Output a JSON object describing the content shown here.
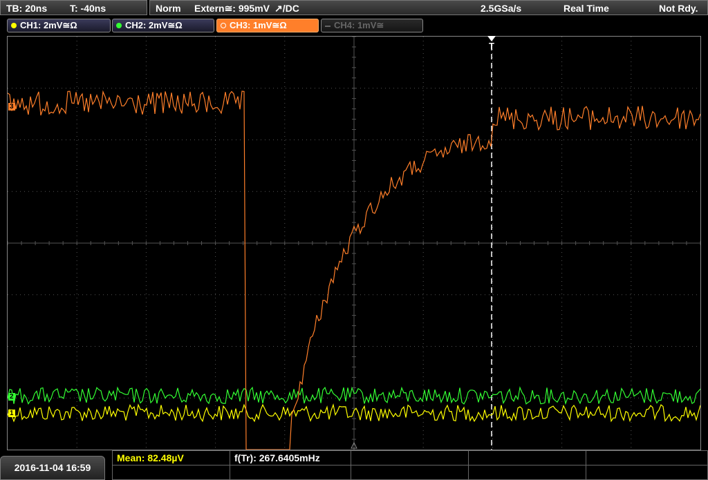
{
  "header": {
    "tb": "TB: 20ns",
    "t": "T: -40ns",
    "mode": "Norm",
    "source": "Extern≅: 995mV",
    "slope": "↗/DC",
    "sample_rate": "2.5GSa/s",
    "acq_mode": "Real Time",
    "status": "Not Rdy."
  },
  "channels": [
    {
      "label": "CH1: 2mV≅Ω",
      "color": "#ffff00"
    },
    {
      "label": "CH2: 2mV≅Ω",
      "color": "#33ff33"
    },
    {
      "label": "CH3: 1mV≅Ω",
      "color": "#ff7f2a"
    },
    {
      "label": "CH4: 1mV≅",
      "color": "#666666"
    }
  ],
  "markers": {
    "ch3": "3",
    "ch2": "2",
    "ch1": "1",
    "trigger": "T"
  },
  "footer": {
    "date": "2016-11-04 16:59",
    "mean_label": "Mean: 82.48µV",
    "freq_label": "f(Tr): 267.6405mHz"
  },
  "colors": {
    "grid": "#555555",
    "ch1": "#ffff00",
    "ch2": "#33ff33",
    "ch3": "#ff7f2a"
  }
}
